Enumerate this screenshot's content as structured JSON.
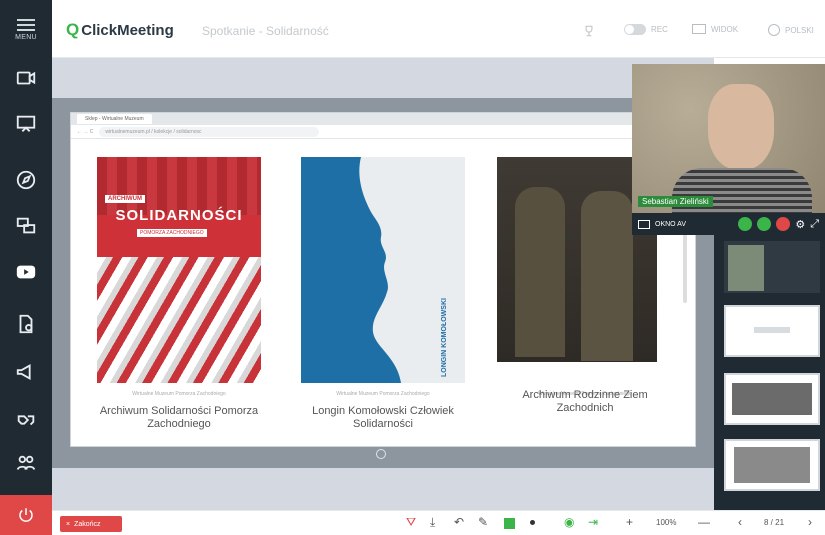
{
  "sidebar": {
    "menu_label": "MENU",
    "items": [
      "video-camera-icon",
      "whiteboard-icon",
      "compass-icon",
      "screen-share-icon",
      "youtube-icon",
      "files-icon",
      "megaphone-icon",
      "handshake-icon",
      "attendees-icon"
    ],
    "exit_icon": "power-icon"
  },
  "header": {
    "logo_text": "ClickMeeting",
    "meeting_title": "Spotkanie - Solidarność",
    "rec_label": "REC",
    "window_label": "WIDOK",
    "lang_label": "POLSKI"
  },
  "browser": {
    "tab_label": "Sklep - Wirtualne Muzeum",
    "url": "wirtualnemuzeum.pl / kolekcje / solidarnosc"
  },
  "cards": [
    {
      "cover_text_top": "ARCHIWUM",
      "cover_text_main": "SOLIDARNOŚCI",
      "cover_text_sub": "POMORZA ZACHODNIEGO",
      "subtitle": "Wirtualne Muzeum Pomorza Zachodniego",
      "title": "Archiwum Solidarności Pomorza Zachodniego"
    },
    {
      "cover_text_side": "LONGIN KOMOŁOWSKI",
      "subtitle": "Wirtualne Muzeum Pomorza Zachodniego",
      "title": "Longin Komołowski Człowiek Solidarności"
    },
    {
      "subtitle": "Wirtualne Muzeum Pomorza Zachodniego",
      "title": "Archiwum Rodzinne Ziem Zachodnich"
    }
  ],
  "video": {
    "presenter_name": "Sebastian Zieliński",
    "av_label": "OKNO AV"
  },
  "bottom": {
    "end_label": "Zakończ",
    "zoom": "100%",
    "page": "8 / 21"
  },
  "colors": {
    "accent": "#3bb44a",
    "danger": "#e04848",
    "sidebar": "#1f2a33"
  }
}
